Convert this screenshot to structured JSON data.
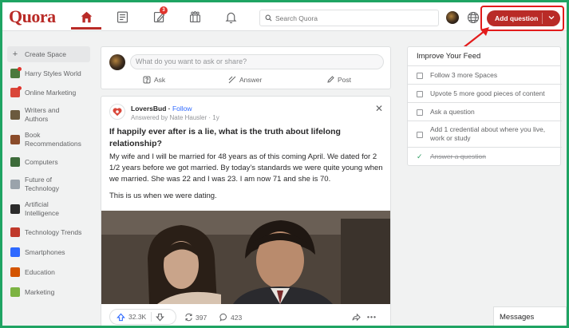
{
  "header": {
    "logo": "Quora",
    "notification_count": "3",
    "search_placeholder": "Search Quora",
    "add_question": "Add question"
  },
  "sidebar": {
    "items": [
      {
        "label": "Create Space",
        "icon": "plus-icon"
      },
      {
        "label": "Harry Styles World",
        "icon": "space-icon",
        "color": "#4b7a3d",
        "dot": true
      },
      {
        "label": "Online Marketing",
        "icon": "space-icon",
        "color": "#d9473a",
        "dot": true
      },
      {
        "label": "Writers and Authors",
        "icon": "space-icon",
        "color": "#6b5a3e"
      },
      {
        "label": "Book Recommendations",
        "icon": "space-icon",
        "color": "#8a4b2a"
      },
      {
        "label": "Computers",
        "icon": "space-icon",
        "color": "#3d6b3a"
      },
      {
        "label": "Future of Technology",
        "icon": "space-icon",
        "color": "#9aa3ab"
      },
      {
        "label": "Artificial Intelligence",
        "icon": "space-icon",
        "color": "#2b2b2b"
      },
      {
        "label": "Technology Trends",
        "icon": "space-icon",
        "color": "#c0392b"
      },
      {
        "label": "Smartphones",
        "icon": "space-icon",
        "color": "#2e69ff"
      },
      {
        "label": "Education",
        "icon": "space-icon",
        "color": "#d35400"
      },
      {
        "label": "Marketing",
        "icon": "space-icon",
        "color": "#7cb342"
      }
    ]
  },
  "composer": {
    "placeholder": "What do you want to ask or share?",
    "ask": "Ask",
    "answer": "Answer",
    "post": "Post"
  },
  "post": {
    "author": "LoversBud",
    "separator": " · ",
    "follow": "Follow",
    "meta": "Answered by Nate Hausler · 1y",
    "title": "If happily ever after is a lie, what is the truth about lifelong relationship?",
    "body": "My wife and I will be married for 48 years as of this coming April. We dated for 2 1/2 years before we got married. By today’s standards we were quite young when we married. She was 22 and I was 23. I am now 71 and she is 70.",
    "body2": "This is us when we were dating.",
    "upvotes": "32.3K",
    "shares": "397",
    "comments": "423"
  },
  "feed": {
    "title": "Improve Your Feed",
    "items": [
      {
        "label": "Follow 3 more Spaces",
        "done": false
      },
      {
        "label": "Upvote 5 more good pieces of content",
        "done": false
      },
      {
        "label": "Ask a question",
        "done": false
      },
      {
        "label": "Add 1 credential about where you live, work or study",
        "done": false
      },
      {
        "label": "Answer a question",
        "done": true
      }
    ]
  },
  "messages": "Messages",
  "colors": {
    "brand": "#b92b27",
    "link": "#2e69ff",
    "frame": "#1fa463",
    "highlight": "#e31b1b"
  }
}
